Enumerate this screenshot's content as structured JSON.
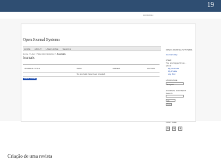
{
  "slide": {
    "number": "19",
    "date": "10/09/2014",
    "caption": "Criação de uma revista"
  },
  "app": {
    "title": "Open Journal Systems",
    "nav": [
      "HOME",
      "ABOUT",
      "USER HOME",
      "SEARCH"
    ],
    "breadcrumb": {
      "prefix": "Home > User > Site Administration > ",
      "current": "Journals"
    },
    "heading": "Journals",
    "table": {
      "headers": [
        "JOURNAL TITLE",
        "PATH",
        "ORDER",
        "ACTION"
      ],
      "empty_text": "No journals have been created."
    },
    "create_link": "CREATE JOURNAL"
  },
  "sidebar": {
    "ojs_label": "OPEN JOURNAL SYSTEMS",
    "help_label": "Journal Help",
    "user_label": "USER",
    "logged_in_text": "You are logged in as...",
    "username": "admin",
    "user_links": [
      "My Journals",
      "My Profile",
      "Log Out"
    ],
    "language_label": "LANGUAGE",
    "language_value": "English",
    "content_label": "JOURNAL CONTENT",
    "search_label": "Search",
    "search_scope": "All",
    "search_button": "Search",
    "font_size_label": "FONT SIZE",
    "font_icons": [
      "A",
      "A",
      "A"
    ],
    "link_color": "#2a57b5"
  }
}
